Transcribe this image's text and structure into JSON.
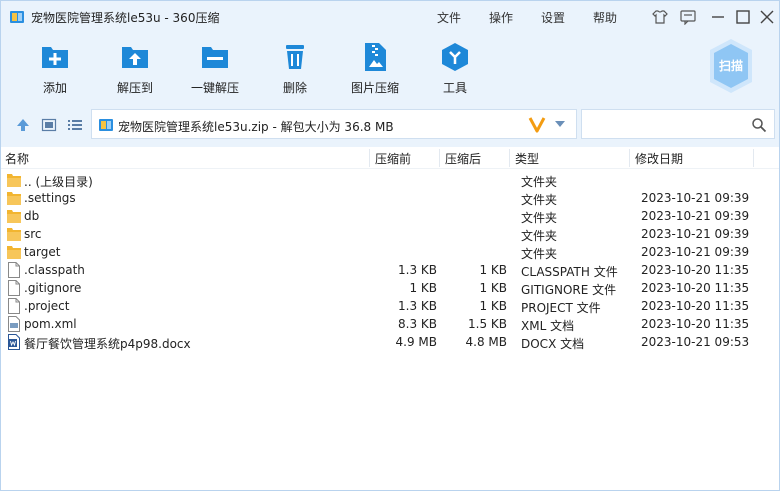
{
  "window": {
    "title": "宠物医院管理系统le53u - 360压缩",
    "menu": [
      "文件",
      "操作",
      "设置",
      "帮助"
    ]
  },
  "toolbar": {
    "tools": [
      {
        "label": "添加",
        "icon": "add-icon"
      },
      {
        "label": "解压到",
        "icon": "extract-to-icon"
      },
      {
        "label": "一键解压",
        "icon": "one-click-extract-icon"
      },
      {
        "label": "删除",
        "icon": "delete-icon"
      },
      {
        "label": "图片压缩",
        "icon": "image-compress-icon"
      },
      {
        "label": "工具",
        "icon": "tools-icon"
      }
    ],
    "scan_label": "扫描"
  },
  "address": {
    "path": "宠物医院管理系统le53u.zip - 解包大小为 36.8 MB",
    "search_placeholder": ""
  },
  "columns": {
    "name": "名称",
    "size": "压缩前",
    "csize": "压缩后",
    "type": "类型",
    "date": "修改日期"
  },
  "files": [
    {
      "name": ".. (上级目录)",
      "size": "",
      "csize": "",
      "type": "文件夹",
      "date": "",
      "kind": "folder"
    },
    {
      "name": ".settings",
      "size": "",
      "csize": "",
      "type": "文件夹",
      "date": "2023-10-21 09:39",
      "kind": "folder"
    },
    {
      "name": "db",
      "size": "",
      "csize": "",
      "type": "文件夹",
      "date": "2023-10-21 09:39",
      "kind": "folder"
    },
    {
      "name": "src",
      "size": "",
      "csize": "",
      "type": "文件夹",
      "date": "2023-10-21 09:39",
      "kind": "folder"
    },
    {
      "name": "target",
      "size": "",
      "csize": "",
      "type": "文件夹",
      "date": "2023-10-21 09:39",
      "kind": "folder"
    },
    {
      "name": ".classpath",
      "size": "1.3 KB",
      "csize": "1 KB",
      "type": "CLASSPATH 文件",
      "date": "2023-10-20 11:35",
      "kind": "file"
    },
    {
      "name": ".gitignore",
      "size": "1 KB",
      "csize": "1 KB",
      "type": "GITIGNORE 文件",
      "date": "2023-10-20 11:35",
      "kind": "file"
    },
    {
      "name": ".project",
      "size": "1.3 KB",
      "csize": "1 KB",
      "type": "PROJECT 文件",
      "date": "2023-10-20 11:35",
      "kind": "file"
    },
    {
      "name": "pom.xml",
      "size": "8.3 KB",
      "csize": "1.5 KB",
      "type": "XML 文档",
      "date": "2023-10-20 11:35",
      "kind": "xml"
    },
    {
      "name": "餐厅餐饮管理系统p4p98.docx",
      "size": "4.9 MB",
      "csize": "4.8 MB",
      "type": "DOCX 文档",
      "date": "2023-10-21 09:53",
      "kind": "docx"
    }
  ],
  "colors": {
    "accent": "#1e88d8",
    "toolbar_bg": "#eaf3fc",
    "folder": "#f2b530"
  }
}
